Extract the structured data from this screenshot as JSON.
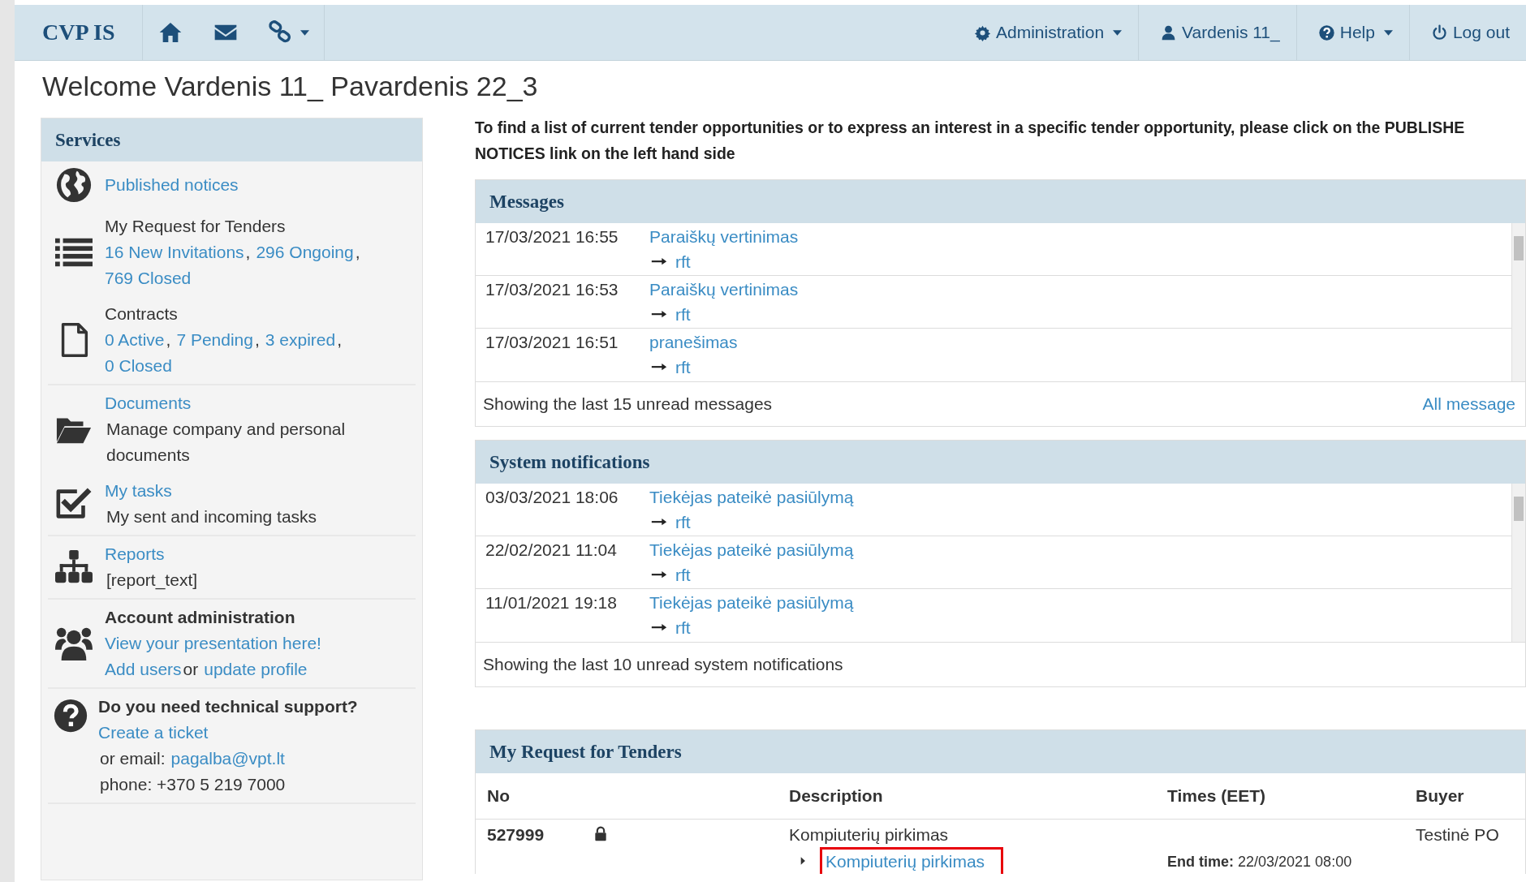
{
  "navbar": {
    "brand": "CVP IS",
    "icons": [
      {
        "dropdown": false
      },
      {
        "dropdown": false
      },
      {
        "dropdown": true
      }
    ],
    "menus": [
      {
        "label": "Administration",
        "dropdown": true
      },
      {
        "label": "Vardenis 11_",
        "dropdown": false
      },
      {
        "label": "Help",
        "dropdown": true
      },
      {
        "label": "Log out",
        "dropdown": false
      }
    ]
  },
  "welcome": "Welcome Vardenis 11_ Pavardenis 22_3",
  "sidebar": {
    "title": "Services",
    "items": [
      {
        "kind": "link",
        "title": "Published notices",
        "divider": false
      },
      {
        "kind": "plain",
        "title": "My Request for Tenders",
        "lines": [
          [
            {
              "text": "16 New Invitations",
              "link": true
            },
            {
              "text": ",",
              "link": false
            },
            {
              "text": "296 Ongoing",
              "link": true
            },
            {
              "text": ",",
              "link": false
            },
            {
              "text": "769 Closed",
              "link": true
            }
          ]
        ],
        "divider": false
      },
      {
        "kind": "plain",
        "title": "Contracts",
        "lines": [
          [
            {
              "text": "0 Active",
              "link": true
            },
            {
              "text": ",",
              "link": false
            },
            {
              "text": "7 Pending",
              "link": true
            },
            {
              "text": ",",
              "link": false
            },
            {
              "text": "3 expired",
              "link": true
            },
            {
              "text": ",",
              "link": false
            }
          ],
          [
            {
              "text": "0 Closed",
              "link": true
            }
          ]
        ],
        "divider": true
      },
      {
        "kind": "link",
        "title": "Documents",
        "lines": [
          [
            {
              "text": "Manage company and personal documents",
              "link": false
            }
          ]
        ],
        "divider": false
      },
      {
        "kind": "link",
        "title": "My tasks",
        "lines": [
          [
            {
              "text": "My sent and incoming tasks",
              "link": false
            }
          ]
        ],
        "divider": true
      },
      {
        "kind": "link",
        "title": "Reports",
        "lines": [
          [
            {
              "text": "[report_text]",
              "link": false
            }
          ]
        ],
        "divider": true
      },
      {
        "kind": "bold",
        "title": "Account administration",
        "lines": [
          [
            {
              "text": "View your presentation here!",
              "link": true
            }
          ],
          [
            {
              "text": "Add users",
              "link": true
            },
            {
              "text": "or",
              "link": false
            },
            {
              "text": "update profile",
              "link": true
            }
          ]
        ],
        "divider": true
      },
      {
        "kind": "bold",
        "title": "Do you need technical support?",
        "lines": [
          [
            {
              "text": "Create a ticket",
              "link": true
            }
          ],
          [
            {
              "text": "or email:",
              "link": false
            },
            {
              "text": "pagalba@vpt.lt",
              "link": true
            }
          ],
          [
            {
              "text": "phone: +370 5 219 7000",
              "link": false
            }
          ]
        ],
        "divider": true
      }
    ]
  },
  "intro_lines": [
    "To find a list of current tender opportunities or to express an interest in a specific tender opportunity, please click on the PUBLISHE",
    "NOTICES link on the left hand side"
  ],
  "messages": {
    "title": "Messages",
    "rows": [
      {
        "date": "17/03/2021 16:55",
        "subject": "Paraiškų vertinimas",
        "target": "rft"
      },
      {
        "date": "17/03/2021 16:53",
        "subject": "Paraiškų vertinimas",
        "target": "rft"
      },
      {
        "date": "17/03/2021 16:51",
        "subject": "pranešimas",
        "target": "rft"
      }
    ],
    "footer": "Showing the last 15 unread messages",
    "all_link": "All message"
  },
  "system_notifications": {
    "title": "System notifications",
    "rows": [
      {
        "date": "03/03/2021 18:06",
        "subject": "Tiekėjas pateikė pasiūlymą",
        "target": "rft"
      },
      {
        "date": "22/02/2021 11:04",
        "subject": "Tiekėjas pateikė pasiūlymą",
        "target": "rft"
      },
      {
        "date": "11/01/2021 19:18",
        "subject": "Tiekėjas pateikė pasiūlymą",
        "target": "rft"
      }
    ],
    "footer": "Showing the last 10 unread system notifications"
  },
  "tenders": {
    "title": "My Request for Tenders",
    "columns": [
      "No",
      "Description",
      "Times (EET)",
      "Buyer"
    ],
    "rows": [
      {
        "no": "527999",
        "locked": true,
        "description": "Kompiuterių pirkimas",
        "lot": {
          "title": "Kompiuterių pirkimas",
          "highlighted": true
        },
        "time": "**End time:** 22/03/2021 08:00",
        "buyer": "Testinė PO"
      }
    ]
  }
}
